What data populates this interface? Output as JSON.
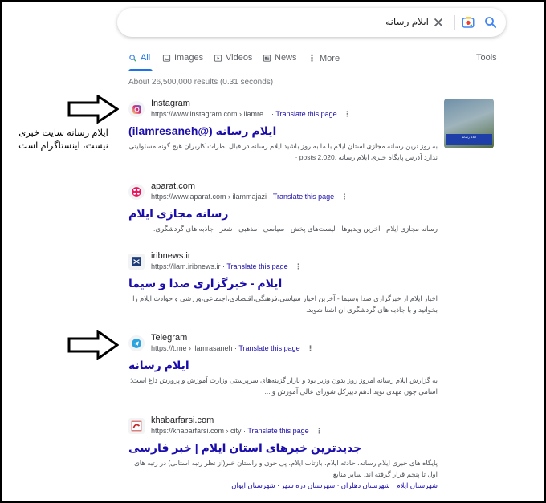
{
  "search": {
    "query": "ایلام رسانه"
  },
  "tabs": [
    {
      "label": "All",
      "icon": "search-icon",
      "active": true
    },
    {
      "label": "Images",
      "icon": "image-icon"
    },
    {
      "label": "Videos",
      "icon": "play-icon"
    },
    {
      "label": "News",
      "icon": "news-icon"
    },
    {
      "label": "More",
      "icon": "more-dots-icon"
    }
  ],
  "tools_label": "Tools",
  "stats": "About 26,500,000 results (0.31 seconds)",
  "results": [
    {
      "site": "Instagram",
      "url": "https://www.instagram.com › ilamre...",
      "translate": "Translate this page",
      "title": "ایلام رسانه (@ilamresaneh)",
      "snippet": "به روز ترین رسانه مجازی استان ایلام با ما به روز باشید ایلام رسانه در قبال نظرات کاربران هیچ گونه مسئولیتی ندارد آدرس پایگاه خبری ایلام رسانه .posts 2,020 ·",
      "icon": "instagram-icon"
    },
    {
      "site": "aparat.com",
      "url": "https://www.aparat.com › ilammajazi",
      "translate": "Translate this page",
      "title": "رسانه مجازی ایلام",
      "snippet": "رسانه مجازی ایلام · آخرین ویدیوها · لیست‌های پخش · سیاسی · مذهبی · شعر · جاذبه های گردشگری.",
      "icon": "aparat-icon"
    },
    {
      "site": "iribnews.ir",
      "url": "https://ilam.iribnews.ir",
      "translate": "Translate this page",
      "title": "ایلام - خبرگزاری صدا و سیما",
      "snippet": "اخبار ایلام از خبرگزاری صدا وسیما - آخرین اخبار سیاسی،فرهنگی،اقتصادی،اجتماعی،ورزشی و حوادث ایلام را بخوانید و با جاذبه های گردشگری آن آشنا شوید.",
      "icon": "irib-icon"
    },
    {
      "site": "Telegram",
      "url": "https://t.me › ilamrasaneh",
      "translate": "Translate this page",
      "title": "ایلام رسانه",
      "snippet": "به گزارش ایلام رسانه امروز روز بدون وزیر بود و بازار گزینه‌های سرپرستی وزارت آموزش و پرورش داغ است؛ اسامی چون مهدی نوید ادهم دبیرکل شورای عالی آموزش و ...",
      "icon": "telegram-icon"
    },
    {
      "site": "khabarfarsi.com",
      "url": "https://khabarfarsi.com › city",
      "translate": "Translate this page",
      "title": "جدیدترین خبرهای استان ایلام | خبر فارسی",
      "snippet": "پایگاه های خبری ایلام رسانه، حادثه ایلام، بازتاب ایلام، پی جوی و راستان خبر(از نظر رتبه استانی) در رتبه های اول تا پنجم قرار گرفته اند. سایر منابع:",
      "sublinks": "شهرستان ایلام · شهرستان دهلران · شهرستان دره شهر · شهرستان ایوان",
      "icon": "khabarfarsi-icon"
    }
  ],
  "thumbnail": {
    "caption": "ایلام رسانه"
  },
  "annotation": {
    "text": "ایلام رسانه سایت خبری نیست، اینستاگرام است"
  }
}
